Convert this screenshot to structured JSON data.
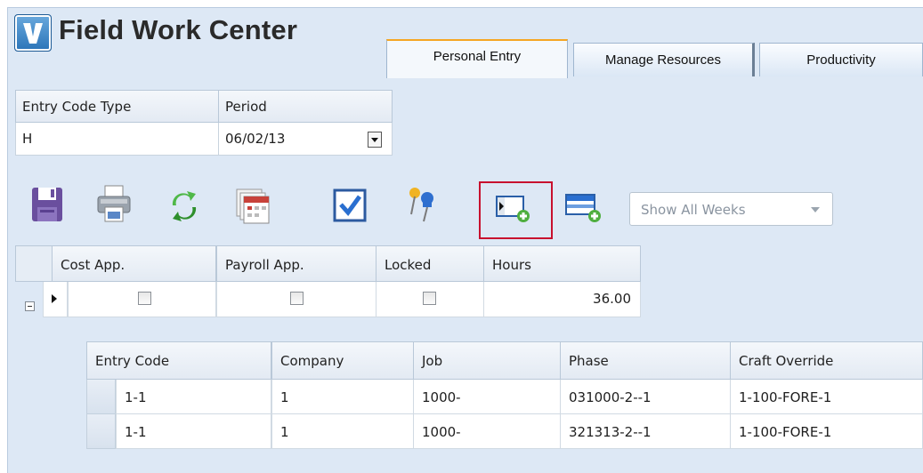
{
  "app": {
    "title": "Field Work Center"
  },
  "tabs": [
    {
      "label": "Personal Entry",
      "active": true
    },
    {
      "label": "Manage Resources",
      "active": false
    },
    {
      "label": "Productivity",
      "active": false
    }
  ],
  "entry": {
    "columns": [
      "Entry Code Type",
      "Period"
    ],
    "values": [
      "H",
      "06/02/13"
    ]
  },
  "toolbar": {
    "icons": [
      "save-icon",
      "print-icon",
      "refresh-icon",
      "calendar-icon",
      "checkbox-icon",
      "pin-icon",
      "add-row-icon",
      "add-detail-icon"
    ],
    "highlighted": "add-row-icon",
    "weeks_dropdown": "Show All Weeks"
  },
  "summary": {
    "columns": [
      "Cost App.",
      "Payroll App.",
      "Locked",
      "Hours"
    ],
    "row": {
      "cost_app": false,
      "payroll_app": false,
      "locked": false,
      "hours": "36.00"
    }
  },
  "detail": {
    "columns": [
      "Entry Code",
      "Company",
      "Job",
      "Phase",
      "Craft Override"
    ],
    "rows": [
      {
        "entry_code": "1-1",
        "company": "1",
        "job": "1000-",
        "phase": "031000-2--1",
        "craft_override": "1-100-FORE-1"
      },
      {
        "entry_code": "1-1",
        "company": "1",
        "job": "1000-",
        "phase": "321313-2--1",
        "craft_override": "1-100-FORE-1"
      }
    ]
  },
  "colors": {
    "background": "#dde8f5",
    "highlight": "#c8102e",
    "active_tab_accent": "#f5a623"
  }
}
